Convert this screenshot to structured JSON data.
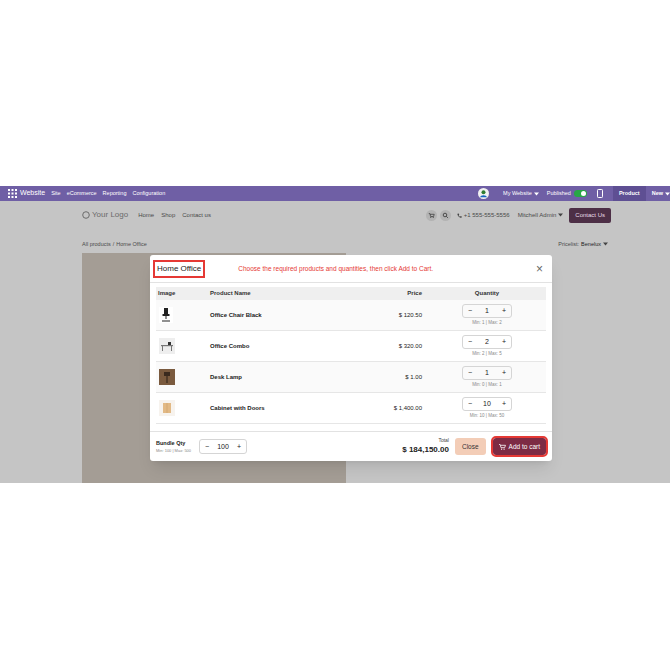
{
  "topbar": {
    "menu": [
      "Website",
      "Site",
      "eCommerce",
      "Reporting",
      "Configuration"
    ],
    "website": "My Website",
    "published_label": "Published",
    "published": true,
    "product": "Product",
    "new": "New"
  },
  "site_header": {
    "logo": "Your Logo",
    "nav": [
      "Home",
      "Shop",
      "Contact us"
    ],
    "phone": "+1 555-555-5556",
    "user": "Mitchell Admin",
    "cta": "Contact Us"
  },
  "breadcrumb": {
    "items": [
      "All products",
      "Home Office"
    ],
    "separator": "/"
  },
  "pricelist": {
    "label": "Pricelist:",
    "value": "Benelux"
  },
  "modal": {
    "title": "Home Office",
    "instruction": "Choose the required products and quantities, then click Add to Cart.",
    "close_icon": "×",
    "columns": [
      "Image",
      "Product Name",
      "Price",
      "Quantity"
    ],
    "rows": [
      {
        "name": "Office Chair Black",
        "price": "$ 120.50",
        "qty": "1",
        "limits": "Min: 1 | Max: 2"
      },
      {
        "name": "Office Combo",
        "price": "$ 320.00",
        "qty": "2",
        "limits": "Min: 2 | Max: 5"
      },
      {
        "name": "Desk Lamp",
        "price": "$ 1.00",
        "qty": "1",
        "limits": "Min: 0 | Max: 1"
      },
      {
        "name": "Cabinet with Doors",
        "price": "$ 1,400.00",
        "qty": "10",
        "limits": "Min: 10 | Max: 50"
      }
    ],
    "minus": "−",
    "plus": "+",
    "footer": {
      "bundle_label": "Bundle Qty",
      "bundle_limits": "Min: 100 | Max: 500",
      "bundle_qty": "100",
      "total_label": "Total",
      "total": "$ 184,150.00",
      "close": "Close",
      "add": "Add to cart"
    }
  }
}
